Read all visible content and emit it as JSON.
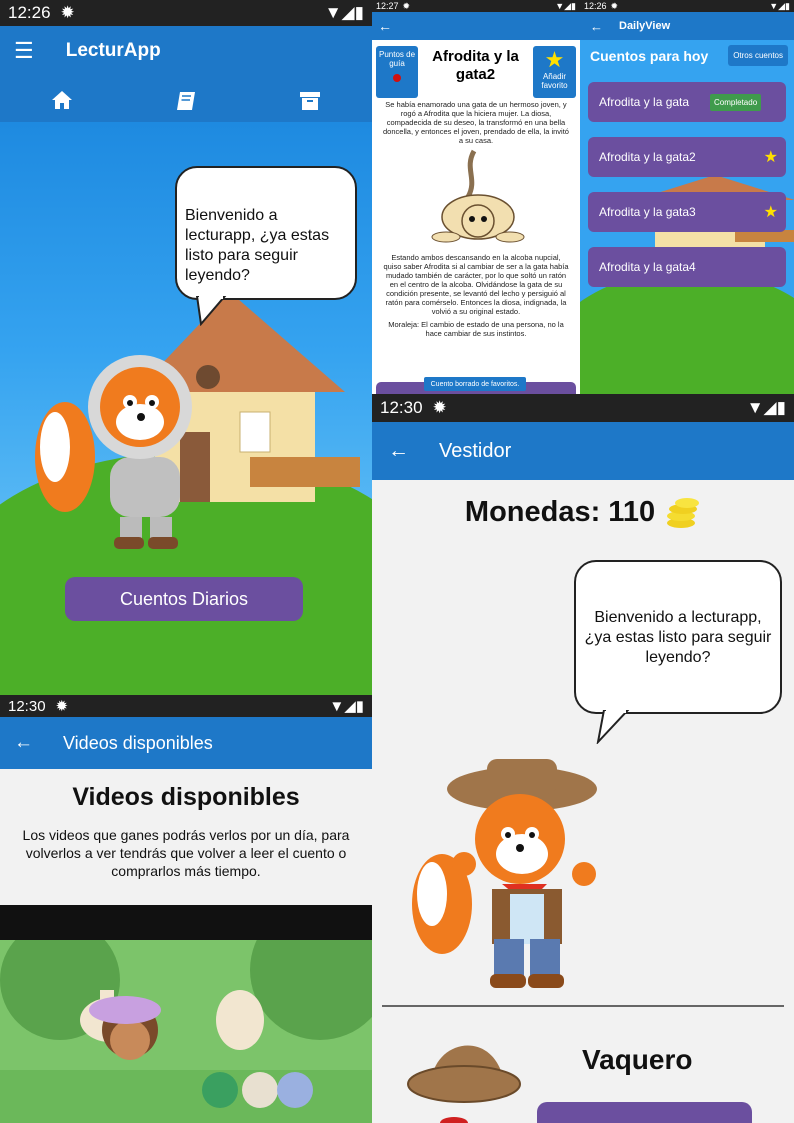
{
  "p1": {
    "status": {
      "time": "12:26"
    },
    "app_title": "LecturApp",
    "tabs": [
      "home-icon",
      "book-icon",
      "archive-icon"
    ],
    "bubble": "Bienvenido a lecturapp, ¿ya estas listo para seguir leyendo?",
    "button": "Cuentos Diarios"
  },
  "p2": {
    "status": {
      "time": "12:27"
    },
    "guide": "Puntos de guía",
    "title": "Afrodita y la gata2",
    "fav": "Añadir favorito",
    "para1": "Se había enamorado una gata de un hermoso joven, y rogó a Afrodita que la hiciera mujer. La diosa, compadecida de su deseo, la transformó en una bella doncella, y entonces el joven, prendado de ella, la invitó a su casa.",
    "para2": "Estando ambos descansando en la alcoba nupcial, quiso saber Afrodita si al cambiar de ser a la gata había mudado también de carácter, por lo que soltó un ratón en el centro de la alcoba. Olvidándose la gata de su condición presente, se levantó del lecho y persiguió al ratón para comérselo. Entonces la diosa, indignada, la volvió a su original estado.",
    "para3": "Moraleja: El cambio de estado de una persona, no la hace cambiar de sus instintos.",
    "toast": "Cuento borrado de favoritos."
  },
  "p3": {
    "status": {
      "time": "12:26"
    },
    "title": "DailyView",
    "heading": "Cuentos para hoy",
    "other": "Otros cuentos",
    "items": [
      {
        "label": "Afrodita y la gata",
        "badge": "Completado"
      },
      {
        "label": "Afrodita y la gata2",
        "star": "★"
      },
      {
        "label": "Afrodita y la gata3",
        "star": "★"
      },
      {
        "label": "Afrodita y la gata4"
      }
    ]
  },
  "p4": {
    "status": {
      "time": "12:30"
    },
    "title": "Videos disponibles",
    "heading": "Videos disponibles",
    "desc": "Los videos que ganes podrás verlos por un día, para volverlos a ver tendrás que volver a leer el cuento o comprarlos más tiempo."
  },
  "p5": {
    "status": {
      "time": "12:30"
    },
    "title": "Vestidor",
    "coins": "Monedas: 110",
    "bubble": "Bienvenido a lecturapp, ¿ya estas listo para seguir leyendo?",
    "outfit": "Vaquero"
  },
  "colors": {
    "appbar": "#1e78c8",
    "button": "#6b4f9f",
    "badge": "#3f9b4c",
    "star": "#ffe000"
  }
}
